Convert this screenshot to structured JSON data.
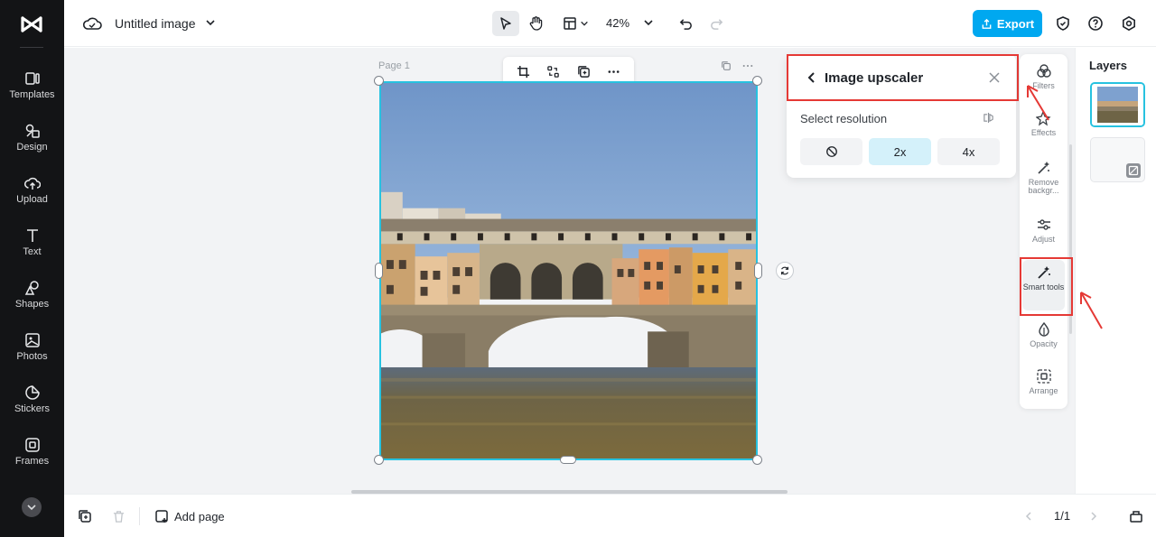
{
  "sidebar": {
    "items": [
      {
        "label": "Templates",
        "icon": "templates-icon"
      },
      {
        "label": "Design",
        "icon": "design-icon"
      },
      {
        "label": "Upload",
        "icon": "upload-icon"
      },
      {
        "label": "Text",
        "icon": "text-icon"
      },
      {
        "label": "Shapes",
        "icon": "shapes-icon"
      },
      {
        "label": "Photos",
        "icon": "photos-icon"
      },
      {
        "label": "Stickers",
        "icon": "stickers-icon"
      },
      {
        "label": "Frames",
        "icon": "frames-icon"
      }
    ]
  },
  "header": {
    "title": "Untitled image",
    "zoom": "42%",
    "export_label": "Export"
  },
  "canvas": {
    "page_label": "Page 1"
  },
  "upscaler": {
    "title": "Image upscaler",
    "subtitle": "Select resolution",
    "options": [
      "",
      "2x",
      "4x"
    ],
    "selected": "2x"
  },
  "tools": {
    "items": [
      {
        "label": "Filters"
      },
      {
        "label": "Effects"
      },
      {
        "label": "Remove backgr..."
      },
      {
        "label": "Adjust"
      },
      {
        "label": "Smart tools"
      },
      {
        "label": "Opacity"
      },
      {
        "label": "Arrange"
      }
    ]
  },
  "layers": {
    "title": "Layers"
  },
  "footer": {
    "add_page_label": "Add page",
    "pager": "1/1"
  },
  "colors": {
    "accent": "#00a8f0",
    "selection": "#27c2e0",
    "highlight": "#e53935",
    "sidebar_bg": "#131416"
  }
}
